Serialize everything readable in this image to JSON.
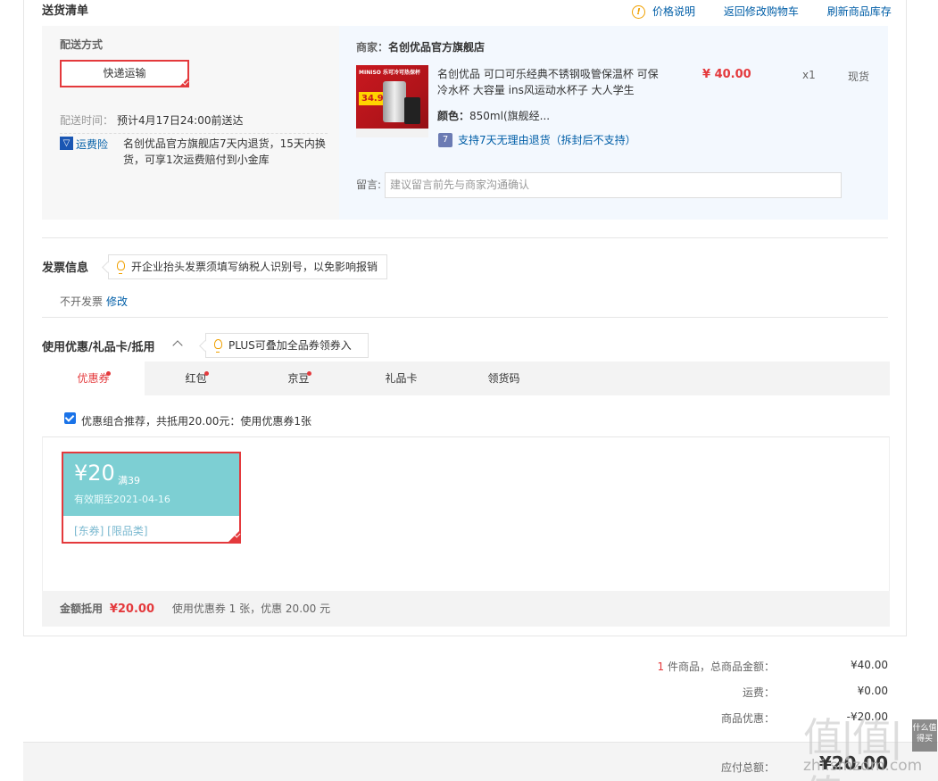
{
  "shipping": {
    "section_title": "送货清单",
    "links": {
      "price_note": "价格说明",
      "back_to_cart": "返回修改购物车",
      "refresh_stock": "刷新商品库存"
    },
    "method_label": "配送方式",
    "method_value": "快递运输",
    "time_label": "配送时间：",
    "time_value": "预计4月17日24:00前送达",
    "insurance_label": "运费险",
    "insurance_desc": "名创优品官方旗舰店7天内退货，15天内换货，可享1次运费赔付到小金库"
  },
  "merchant": {
    "label": "商家：",
    "name": "名创优品官方旗舰店"
  },
  "product": {
    "image_brand": "MINISO 乐可冷可热保杯",
    "image_price": "34.9",
    "title": "名创优品 可口可乐经典不锈钢吸管保温杯 可保冷水杯 大容量 ins风运动水杯子 大人学生",
    "color_label": "颜色：",
    "color_value": "850ml(旗舰经...",
    "return_policy": "支持7天无理由退货（拆封后不支持）",
    "price": "¥ 40.00",
    "quantity": "x1",
    "stock": "现货"
  },
  "message": {
    "label": "留言:",
    "placeholder": "建议留言前先与商家沟通确认"
  },
  "invoice": {
    "title": "发票信息",
    "tip": "开企业抬头发票须填写纳税人识别号，以免影响报销",
    "value": "不开发票",
    "modify": "修改"
  },
  "discount": {
    "title": "使用优惠/礼品卡/抵用",
    "tip": "PLUS可叠加全品券领券入口",
    "tabs": [
      {
        "label": "优惠券",
        "dot": true
      },
      {
        "label": "红包",
        "dot": true
      },
      {
        "label": "京豆",
        "dot": true
      },
      {
        "label": "礼品卡",
        "dot": false
      },
      {
        "label": "领货码",
        "dot": false
      }
    ],
    "recommend_text": "优惠组合推荐，共抵用20.00元：使用优惠券1张",
    "coupon": {
      "amount": "¥20",
      "condition": "满39",
      "expiry": "有效期至2021-04-16",
      "tags": "[东券]  [限品类]"
    },
    "deduct_label": "金额抵用",
    "deduct_amount": "¥20.00",
    "deduct_desc": "使用优惠券 1 张，优惠 20.00 元"
  },
  "summary": {
    "count": "1",
    "count_suffix": "件商品，总商品金额：",
    "goods_total": "¥40.00",
    "shipping_label": "运费：",
    "shipping_fee": "¥0.00",
    "discount_label": "商品优惠：",
    "discount_value": "-¥20.00",
    "payable_label": "应付总额：",
    "payable_value": "¥20.00"
  },
  "watermark": {
    "main": "值|值|值",
    "sub": "什么值得买",
    "url": "zhi.smzdm.com"
  },
  "colors": {
    "accent_red": "#e4393c",
    "link_blue": "#005ea7",
    "coupon_teal": "#7dcfd3"
  }
}
